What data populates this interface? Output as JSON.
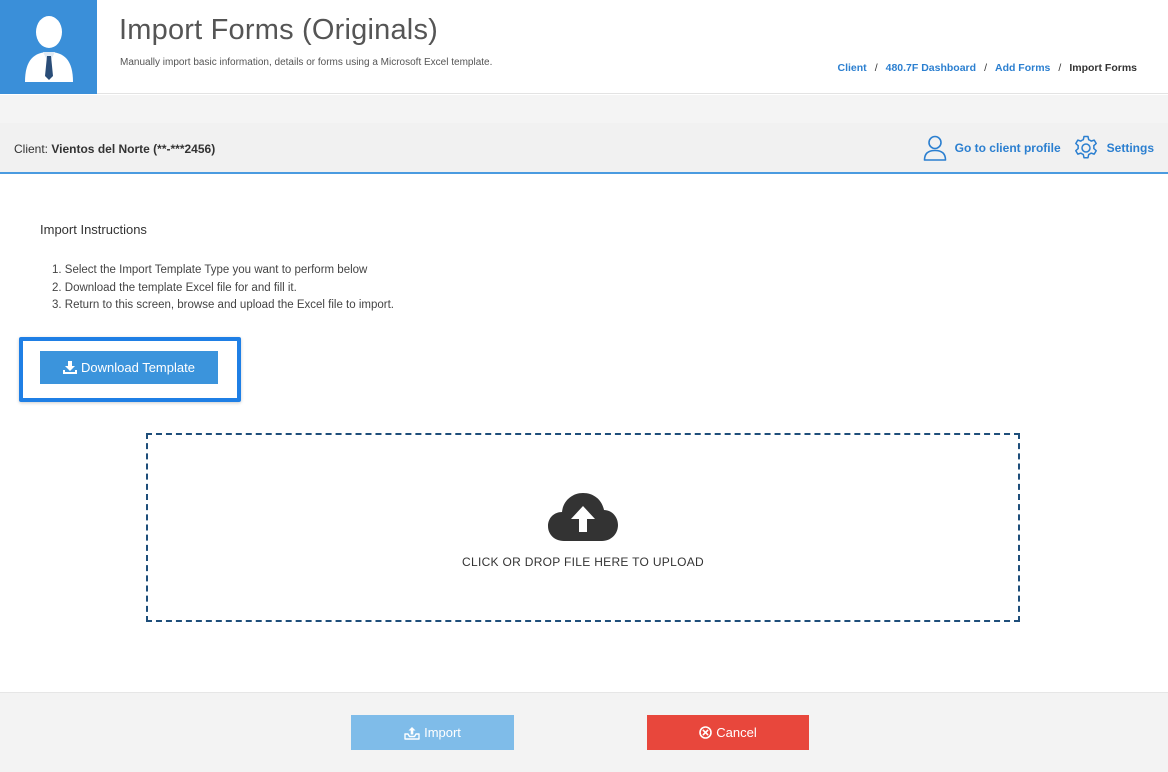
{
  "header": {
    "title": "Import Forms (Originals)",
    "subtitle": "Manually import basic information, details or forms using a Microsoft Excel template.",
    "breadcrumb": [
      {
        "label": "Client"
      },
      {
        "label": "480.7F Dashboard"
      },
      {
        "label": "Add Forms"
      },
      {
        "label": "Import Forms"
      }
    ],
    "separator": "/"
  },
  "client_bar": {
    "prefix": "Client:",
    "name": "Vientos del Norte (**-***2456)",
    "profile_link": "Go to client profile",
    "settings_link": "Settings"
  },
  "instructions": {
    "title": "Import Instructions",
    "steps": [
      "1. Select the Import Template Type you want to perform below",
      "2. Download the template Excel file for and fill it.",
      "3. Return to this screen, browse and upload the Excel file to import."
    ]
  },
  "download_button": {
    "label": "Download Template"
  },
  "dropzone": {
    "label": "CLICK OR DROP FILE HERE TO UPLOAD"
  },
  "footer": {
    "import_label": "Import",
    "cancel_label": "Cancel"
  },
  "colors": {
    "accent": "#3a8fd9",
    "link": "#2b7fd0",
    "highlight": "#1f7fe5",
    "import_disabled": "#7fbce9",
    "cancel": "#e8473c"
  },
  "icons": {
    "avatar": "user-avatar-icon",
    "profile": "user-outline-icon",
    "settings": "gear-icon",
    "download": "download-icon",
    "upload": "cloud-upload-icon",
    "import": "import-icon",
    "cancel": "cancel-circle-icon"
  }
}
